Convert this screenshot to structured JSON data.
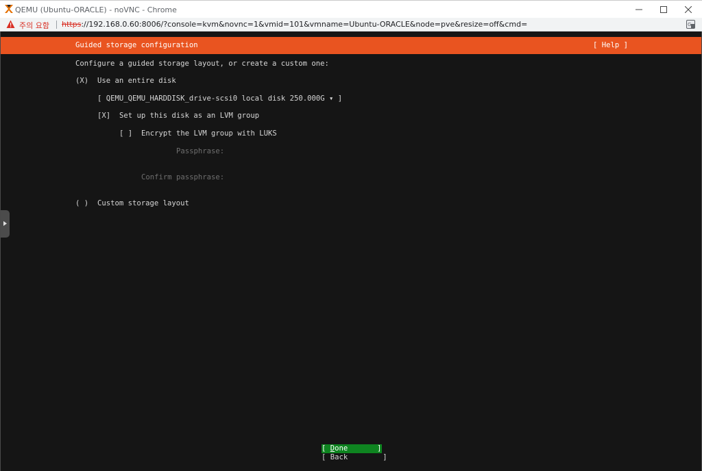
{
  "window": {
    "title": "QEMU (Ubuntu-ORACLE) - noVNC - Chrome",
    "app_icon": "proxmox-x-icon"
  },
  "addressbar": {
    "security_warning": "주의 요함",
    "url_scheme": "https",
    "url_rest": "://192.168.0.60:8006/?console=kvm&novnc=1&vmid=101&vmname=Ubuntu-ORACLE&node=pve&resize=off&cmd="
  },
  "installer": {
    "header_title": "Guided storage configuration",
    "help_label": "[ Help ]",
    "intro": "Configure a guided storage layout, or create a custom one:",
    "entire_disk_mark": "(X)",
    "entire_disk_label": "Use an entire disk",
    "disk_select": "[ QEMU_QEMU_HARDDISK_drive-scsi0 local disk 250.000G ▾ ]",
    "lvm_mark": "[X]",
    "lvm_label": "Set up this disk as an LVM group",
    "encrypt_mark": "[ ]",
    "encrypt_label": "Encrypt the LVM group with LUKS",
    "passphrase_label": "Passphrase:",
    "confirm_label": "Confirm passphrase:",
    "custom_mark": "( )",
    "custom_label": "Custom storage layout",
    "done_open": "[ ",
    "done_hotkey": "D",
    "done_rest": "one",
    "done_close": "]",
    "back_label": "[ Back        ]"
  },
  "colors": {
    "header_orange": "#e95420",
    "done_green": "#0e8420",
    "terminal_bg": "#151515"
  }
}
